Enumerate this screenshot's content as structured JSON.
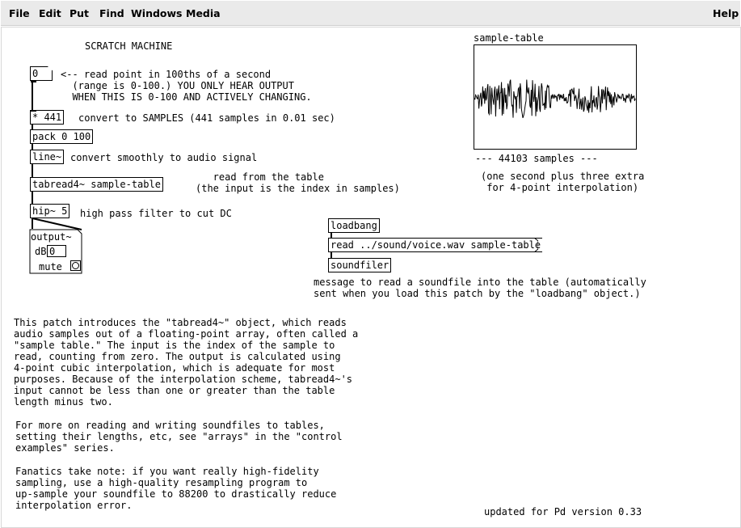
{
  "menubar": {
    "items": [
      "File",
      "Edit",
      "Put",
      "Find",
      "Windows",
      "Media"
    ],
    "help": "Help"
  },
  "patch": {
    "title": "SCRATCH MACHINE",
    "number_box": "0",
    "comment_read_point": "<-- read point in 100ths of a second\n  (range is 0-100.) YOU ONLY HEAR OUTPUT\n  WHEN THIS IS 0-100 AND ACTIVELY CHANGING.",
    "obj_mult": "* 441",
    "comment_samples": "convert to SAMPLES (441 samples in 0.01 sec)",
    "obj_pack": "pack 0 100",
    "obj_line": "line~",
    "comment_line": "convert smoothly to audio signal",
    "obj_tabread": "tabread4~ sample-table",
    "comment_read_table": "   read from the table\n(the input is the index in samples)",
    "obj_hip": "hip~ 5",
    "comment_hip": "high pass filter to cut DC",
    "output": {
      "title": "output~",
      "db_label": "dB",
      "db_value": "0",
      "mute_label": "mute"
    },
    "table_name": "sample-table",
    "samples_label": "--- 44103 samples ---",
    "comment_extra": "(one second plus three extra\n for 4-point interpolation)",
    "obj_loadbang": "loadbang",
    "msg_read": "read ../sound/voice.wav sample-table",
    "obj_soundfiler": "soundfiler",
    "comment_soundfile": "message to read a soundfile into the table (automatically\nsent when you load this patch by the \"loadbang\" object.)",
    "paragraph1": "This patch introduces the \"tabread4~\" object, which reads\naudio samples out of a floating-point array, often called a\n\"sample table.\" The input is the index of the sample to\nread, counting from zero. The output is calculated using\n4-point cubic interpolation, which is adequate for most\npurposes. Because of the interpolation scheme, tabread4~'s\ninput cannot be less than one or greater than the table\nlength minus two.",
    "paragraph2": "For more on reading and writing soundfiles to tables,\nsetting their lengths, etc, see \"arrays\" in the \"control\nexamples\" series.",
    "paragraph3": "Fanatics take note: if you want really high-fidelity\nsampling, use a high-quality resampling program to\nup-sample your soundfile to 88200 to drastically reduce\ninterpolation error.",
    "updated": "updated for Pd version 0.33"
  }
}
